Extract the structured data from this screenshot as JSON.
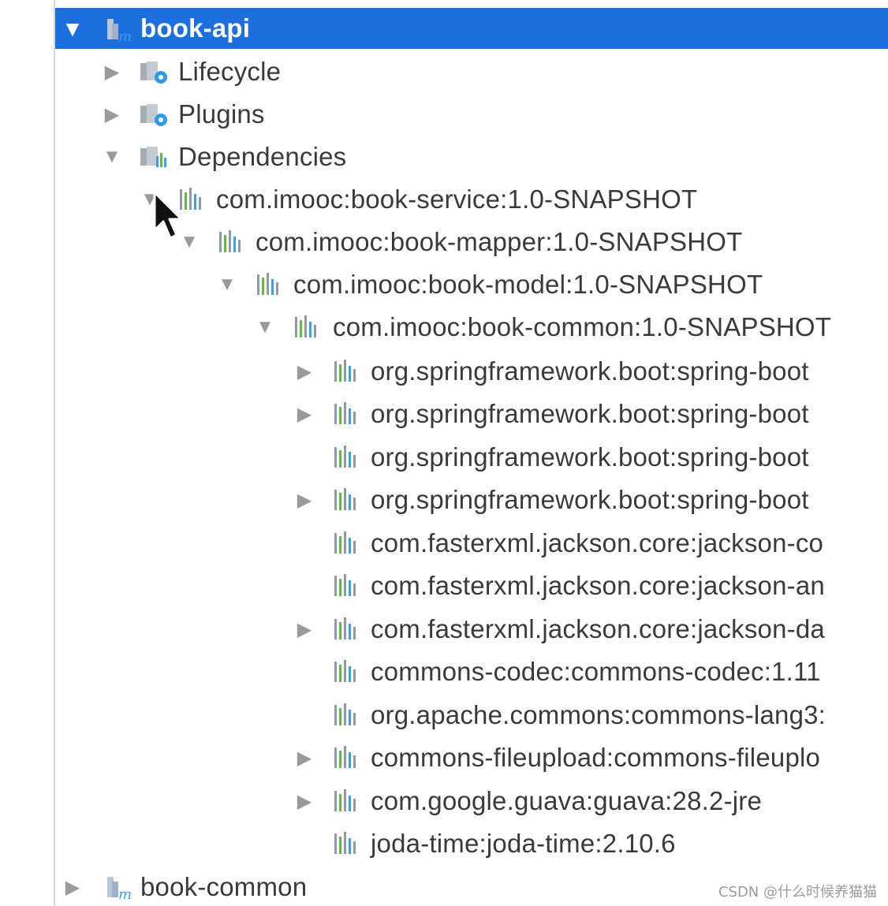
{
  "tree": {
    "rows": [
      {
        "label": "book-api",
        "arrow": "▼",
        "icon": "maven-module-icon",
        "selected": true
      },
      {
        "label": "Lifecycle",
        "arrow": "▶",
        "icon": "lifecycle-folder-icon"
      },
      {
        "label": "Plugins",
        "arrow": "▶",
        "icon": "plugins-folder-icon"
      },
      {
        "label": "Dependencies",
        "arrow": "▼",
        "icon": "dependencies-folder-icon"
      },
      {
        "label": "com.imooc:book-service:1.0-SNAPSHOT",
        "arrow": "▼",
        "icon": "library-icon"
      },
      {
        "label": "com.imooc:book-mapper:1.0-SNAPSHOT",
        "arrow": "▼",
        "icon": "library-icon"
      },
      {
        "label": "com.imooc:book-model:1.0-SNAPSHOT",
        "arrow": "▼",
        "icon": "library-icon"
      },
      {
        "label": "com.imooc:book-common:1.0-SNAPSHOT",
        "arrow": "▼",
        "icon": "library-icon"
      },
      {
        "label": "org.springframework.boot:spring-boot",
        "arrow": "▶",
        "icon": "library-icon"
      },
      {
        "label": "org.springframework.boot:spring-boot",
        "arrow": "▶",
        "icon": "library-icon"
      },
      {
        "label": "org.springframework.boot:spring-boot",
        "arrow": "",
        "icon": "library-icon"
      },
      {
        "label": "org.springframework.boot:spring-boot",
        "arrow": "▶",
        "icon": "library-icon"
      },
      {
        "label": "com.fasterxml.jackson.core:jackson-co",
        "arrow": "",
        "icon": "library-icon"
      },
      {
        "label": "com.fasterxml.jackson.core:jackson-an",
        "arrow": "",
        "icon": "library-icon"
      },
      {
        "label": "com.fasterxml.jackson.core:jackson-da",
        "arrow": "▶",
        "icon": "library-icon"
      },
      {
        "label": "commons-codec:commons-codec:1.11",
        "arrow": "",
        "icon": "library-icon"
      },
      {
        "label": "org.apache.commons:commons-lang3:",
        "arrow": "",
        "icon": "library-icon"
      },
      {
        "label": "commons-fileupload:commons-fileuplo",
        "arrow": "▶",
        "icon": "library-icon"
      },
      {
        "label": "com.google.guava:guava:28.2-jre",
        "arrow": "▶",
        "icon": "library-icon"
      },
      {
        "label": "joda-time:joda-time:2.10.6",
        "arrow": "",
        "icon": "library-icon"
      },
      {
        "label": "book-common",
        "arrow": "▶",
        "icon": "maven-module-icon"
      }
    ]
  },
  "watermark": "CSDN @什么时候养猫猫",
  "colors": {
    "selection": "#1d6fe0",
    "text": "#3a3a3a",
    "arrow": "#9a9a9a"
  }
}
